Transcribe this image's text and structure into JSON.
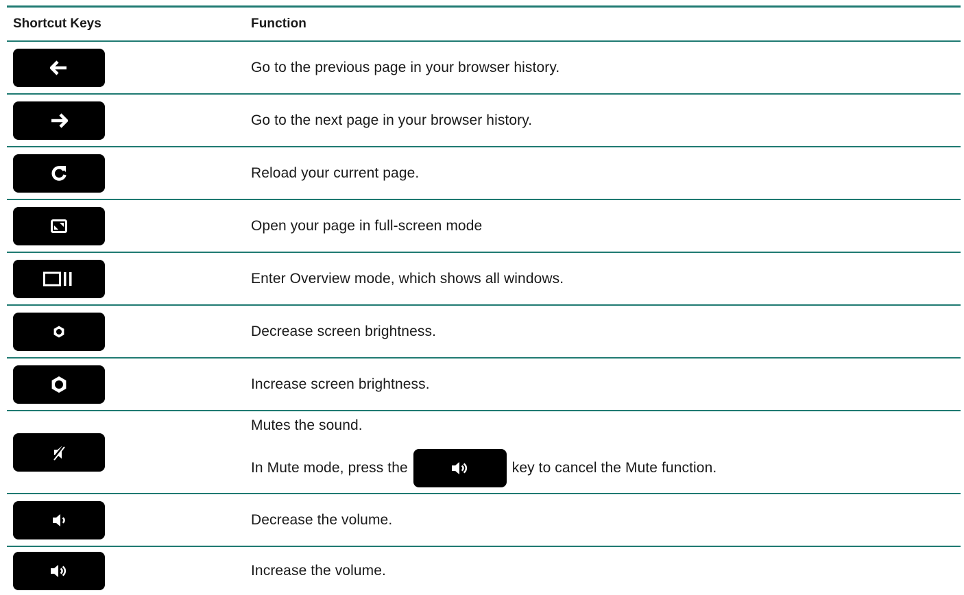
{
  "header": {
    "col_keys": "Shortcut Keys",
    "col_function": "Function"
  },
  "rows": [
    {
      "key_icon": "back-arrow-icon",
      "function": "Go to the previous page in your browser history."
    },
    {
      "key_icon": "forward-arrow-icon",
      "function": "Go to the next page in your browser history."
    },
    {
      "key_icon": "reload-icon",
      "function": "Reload your current page."
    },
    {
      "key_icon": "fullscreen-icon",
      "function": "Open your page in full-screen mode"
    },
    {
      "key_icon": "overview-icon",
      "function": "Enter Overview mode, which shows all windows."
    },
    {
      "key_icon": "brightness-down-icon",
      "function": "Decrease screen brightness."
    },
    {
      "key_icon": "brightness-up-icon",
      "function": "Increase screen brightness."
    },
    {
      "key_icon": "mute-icon",
      "function": "Mutes the sound.",
      "function_line2_before": "In Mute mode, press the",
      "function_line2_key_icon": "volume-up-icon",
      "function_line2_after": "key to cancel the Mute function."
    },
    {
      "key_icon": "volume-down-icon",
      "function": "Decrease the volume."
    },
    {
      "key_icon": "volume-up-icon",
      "function": "Increase the volume."
    }
  ],
  "colors": {
    "rule": "#1f7a72",
    "key_bg": "#000000",
    "key_fg": "#ffffff"
  }
}
